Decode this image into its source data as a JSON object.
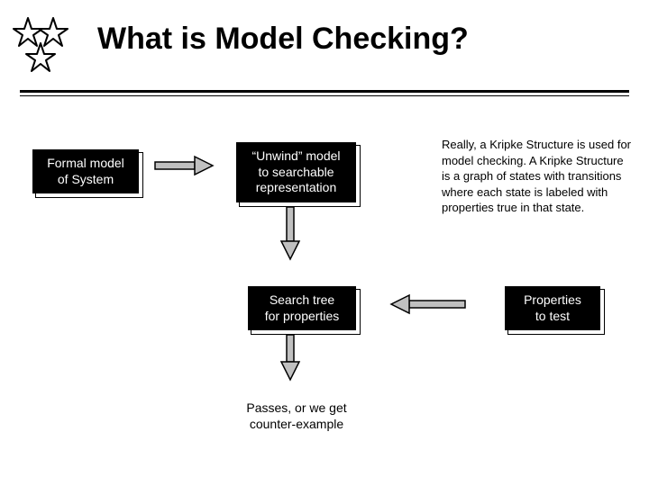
{
  "title": "What is Model Checking?",
  "boxes": {
    "formal": "Formal model\nof System",
    "unwind": "“Unwind” model\nto searchable\nrepresentation",
    "search": "Search tree\nfor properties",
    "properties": "Properties\nto test"
  },
  "labels": {
    "result": "Passes, or we get\ncounter-example"
  },
  "aside": "Really, a Kripke Structure is used for model checking. A Kripke Structure is a graph of states with transitions where each state is labeled with properties true in that state."
}
